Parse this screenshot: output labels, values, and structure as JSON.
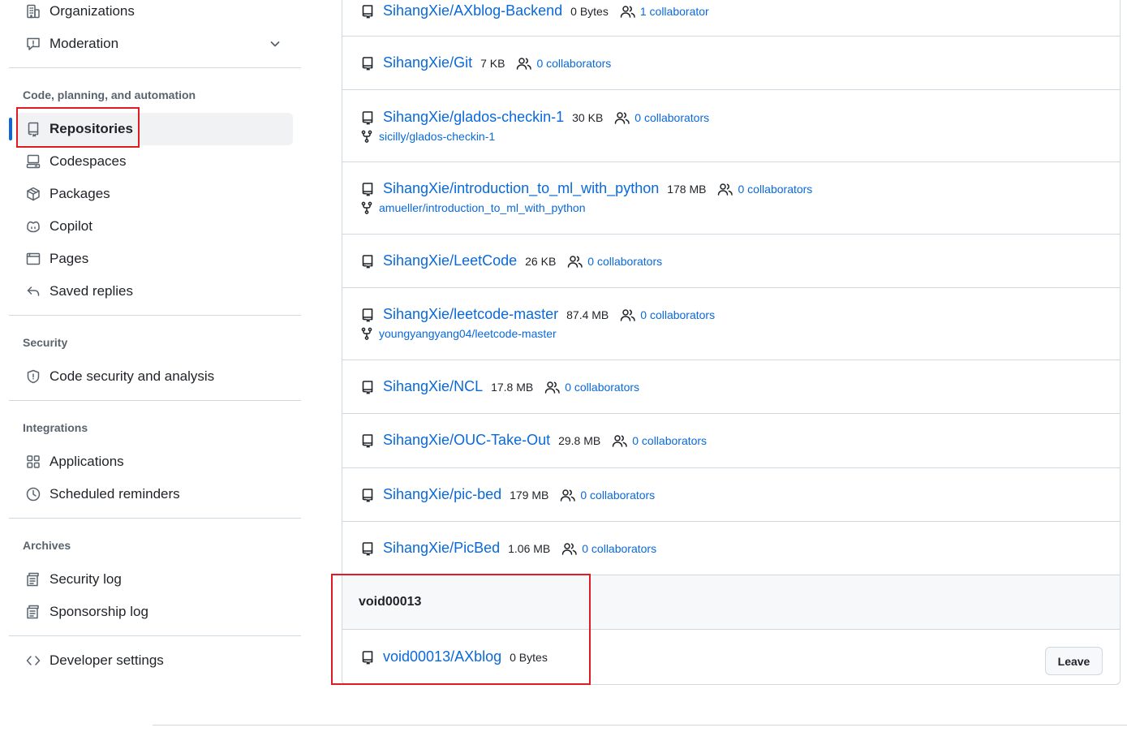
{
  "sidebar": {
    "top_items": [
      {
        "label": "Organizations",
        "icon": "organization-icon"
      },
      {
        "label": "Moderation",
        "icon": "report-icon",
        "expandable": true
      }
    ],
    "sections": [
      {
        "heading": "Code, planning, and automation",
        "items": [
          {
            "label": "Repositories",
            "icon": "repo-icon",
            "active": true
          },
          {
            "label": "Codespaces",
            "icon": "codespaces-icon"
          },
          {
            "label": "Packages",
            "icon": "package-icon"
          },
          {
            "label": "Copilot",
            "icon": "copilot-icon"
          },
          {
            "label": "Pages",
            "icon": "browser-icon"
          },
          {
            "label": "Saved replies",
            "icon": "reply-icon"
          }
        ]
      },
      {
        "heading": "Security",
        "items": [
          {
            "label": "Code security and analysis",
            "icon": "shield-icon"
          }
        ]
      },
      {
        "heading": "Integrations",
        "items": [
          {
            "label": "Applications",
            "icon": "apps-icon"
          },
          {
            "label": "Scheduled reminders",
            "icon": "clock-icon"
          }
        ]
      },
      {
        "heading": "Archives",
        "items": [
          {
            "label": "Security log",
            "icon": "log-icon"
          },
          {
            "label": "Sponsorship log",
            "icon": "log-icon"
          }
        ]
      }
    ],
    "bottom_items": [
      {
        "label": "Developer settings",
        "icon": "code-icon"
      }
    ]
  },
  "repos": [
    {
      "name": "SihangXie/AXblog-Backend",
      "size": "0 Bytes",
      "collaborators": "1 collaborator"
    },
    {
      "name": "SihangXie/Git",
      "size": "7 KB",
      "collaborators": "0 collaborators"
    },
    {
      "name": "SihangXie/glados-checkin-1",
      "size": "30 KB",
      "collaborators": "0 collaborators",
      "fork": "sicilly/glados-checkin-1"
    },
    {
      "name": "SihangXie/introduction_to_ml_with_python",
      "size": "178 MB",
      "collaborators": "0 collaborators",
      "fork": "amueller/introduction_to_ml_with_python"
    },
    {
      "name": "SihangXie/LeetCode",
      "size": "26 KB",
      "collaborators": "0 collaborators"
    },
    {
      "name": "SihangXie/leetcode-master",
      "size": "87.4 MB",
      "collaborators": "0 collaborators",
      "fork": "youngyangyang04/leetcode-master"
    },
    {
      "name": "SihangXie/NCL",
      "size": "17.8 MB",
      "collaborators": "0 collaborators"
    },
    {
      "name": "SihangXie/OUC-Take-Out",
      "size": "29.8 MB",
      "collaborators": "0 collaborators"
    },
    {
      "name": "SihangXie/pic-bed",
      "size": "179 MB",
      "collaborators": "0 collaborators"
    },
    {
      "name": "SihangXie/PicBed",
      "size": "1.06 MB",
      "collaborators": "0 collaborators"
    }
  ],
  "org_section": {
    "title": "void00013",
    "repo": {
      "name": "void00013/AXblog",
      "size": "0 Bytes"
    },
    "leave_label": "Leave"
  },
  "colors": {
    "link": "#0969da",
    "highlight": "#e01b24",
    "active_bar": "#0969da"
  }
}
